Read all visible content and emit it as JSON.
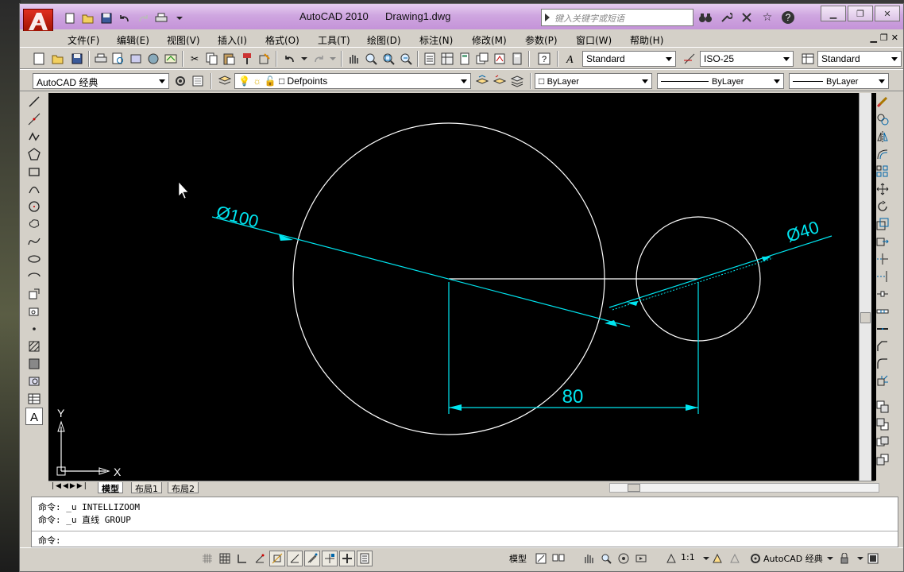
{
  "window": {
    "app_name": "AutoCAD 2010",
    "document_name": "Drawing1.dwg",
    "search_placeholder": "键入关键字或短语"
  },
  "menu": {
    "items": [
      "文件(F)",
      "编辑(E)",
      "视图(V)",
      "插入(I)",
      "格式(O)",
      "工具(T)",
      "绘图(D)",
      "标注(N)",
      "修改(M)",
      "参数(P)",
      "窗口(W)",
      "帮助(H)"
    ]
  },
  "toolbar1": {
    "text_style": "Standard",
    "dim_style": "ISO-25",
    "table_style": "Standard"
  },
  "toolbar2": {
    "workspace": "AutoCAD 经典",
    "layer": "Defpoints",
    "color": "ByLayer",
    "linetype": "ByLayer",
    "lineweight": "ByLayer"
  },
  "drawing": {
    "dimension_large": "Ø100",
    "dimension_small": "Ø40",
    "dimension_distance": "80",
    "ucs_y": "Y",
    "ucs_x": "X",
    "colors": {
      "background": "#000000",
      "geometry": "#ffffff",
      "dimension": "#00e5f0"
    }
  },
  "layout_tabs": [
    "模型",
    "布局1",
    "布局2"
  ],
  "command_window": {
    "lines": [
      "命令:  _u INTELLIZOOM",
      "命令:  _u 直线 GROUP"
    ],
    "prompt": "命令:"
  },
  "status_bar": {
    "model_label": "模型",
    "scale": "1:1",
    "workspace": "AutoCAD 经典"
  }
}
